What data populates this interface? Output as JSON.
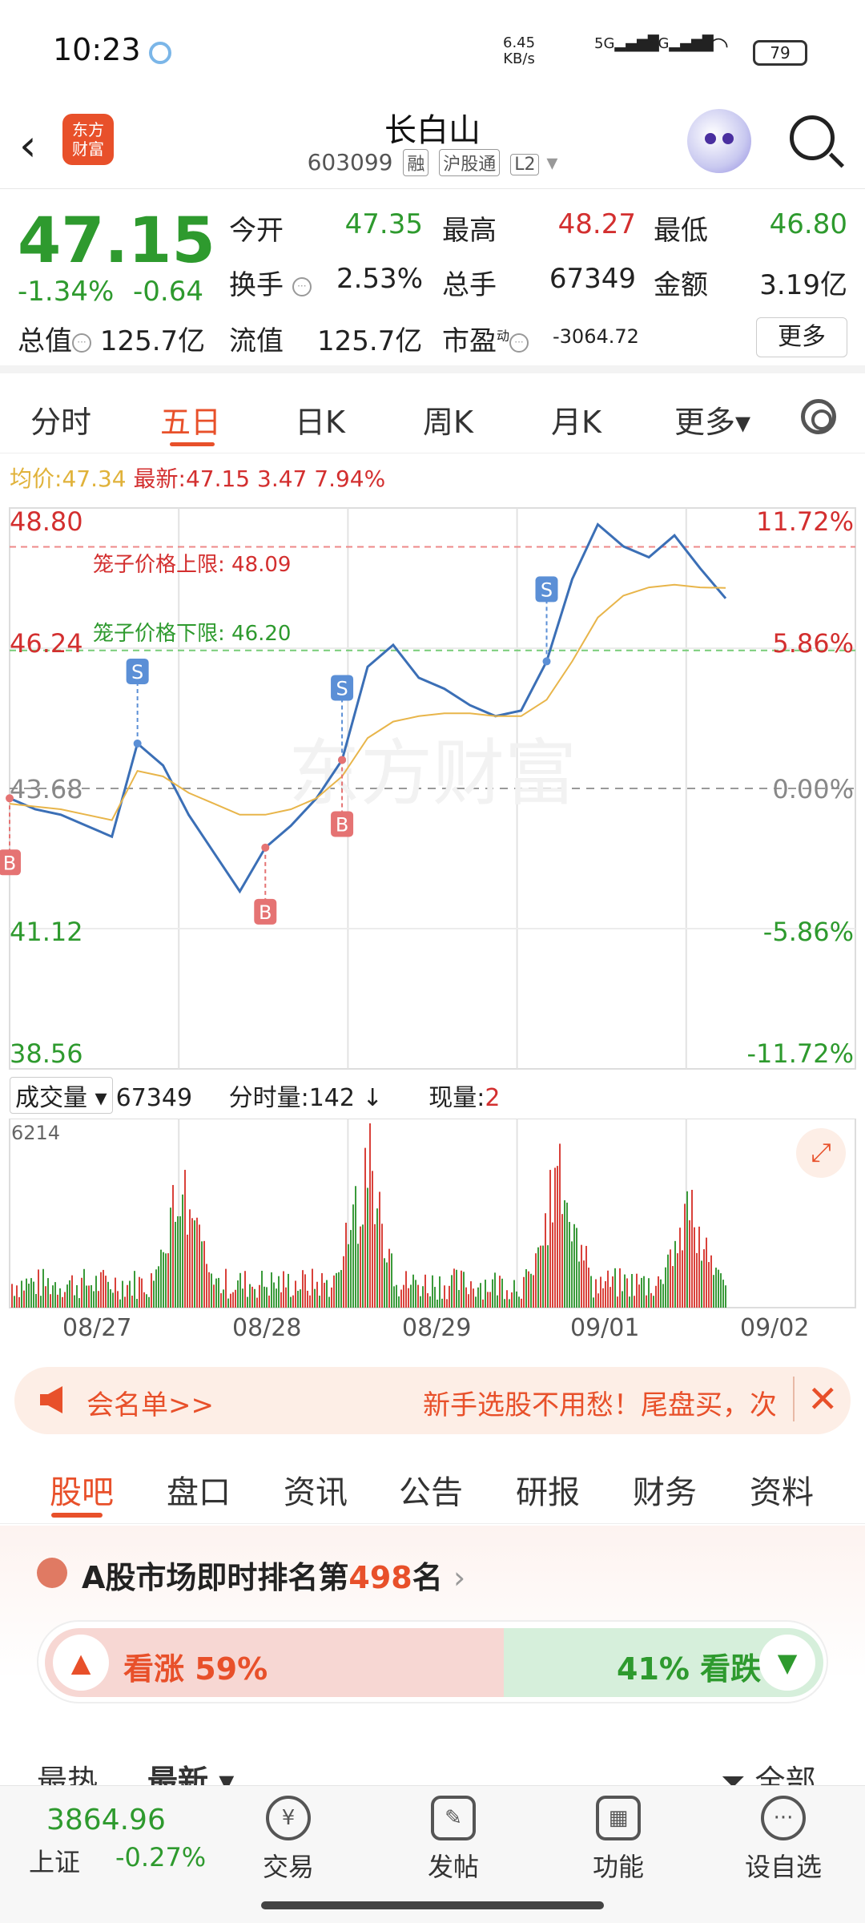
{
  "status": {
    "time": "10:23",
    "speed": "6.45\nKB/s",
    "net1": "5G",
    "net2": "4G",
    "battery": "79"
  },
  "header": {
    "back": "‹",
    "logo": "东方\n财富",
    "title": "长白山",
    "code": "603099",
    "tags": [
      "融",
      "沪股通",
      "L2"
    ]
  },
  "quote": {
    "price": "47.15",
    "chg_pct": "-1.34%",
    "chg": "-0.64",
    "rows": [
      [
        {
          "label": "今开",
          "value": "47.35",
          "color": "green"
        },
        {
          "label": "最高",
          "value": "48.27",
          "color": "red"
        },
        {
          "label": "最低",
          "value": "46.80",
          "color": "green"
        }
      ],
      [
        {
          "label": "换手",
          "value": "2.53%",
          "color": "black"
        },
        {
          "label": "总手",
          "value": "67349",
          "color": "black"
        },
        {
          "label": "金额",
          "value": "3.19亿",
          "color": "black"
        }
      ]
    ],
    "total_cap_label": "总值",
    "total_cap": "125.7亿",
    "float_cap_label": "流值",
    "float_cap": "125.7亿",
    "pe_label": "市盈",
    "pe_sup": "动",
    "pe": "-3064.72",
    "more": "更多"
  },
  "chart_tabs": [
    "分时",
    "五日",
    "日K",
    "周K",
    "月K",
    "更多▾"
  ],
  "avg_line": {
    "avg_label": "均价:",
    "avg": "47.34",
    "latest_label": "最新:",
    "latest": "47.15",
    "amt": "3.47",
    "pct": "7.94%"
  },
  "chart": {
    "left_axis": [
      "48.80",
      "46.24",
      "43.68",
      "41.12",
      "38.56"
    ],
    "right_axis": [
      "11.72%",
      "5.86%",
      "0.00%",
      "-5.86%",
      "-11.72%"
    ],
    "cage_upper": "笼子价格上限: 48.09",
    "cage_lower": "笼子价格下限: 46.20",
    "markers": [
      "B",
      "S",
      "B",
      "S",
      "B",
      "S"
    ],
    "watermark": "东方财富"
  },
  "chart_data": {
    "type": "line",
    "title": "",
    "x": [
      "08/27",
      "08/28",
      "08/29",
      "09/01",
      "09/02"
    ],
    "ylim": [
      38.56,
      48.8
    ],
    "series": [
      {
        "name": "最新",
        "values": [
          43.5,
          43.3,
          43.2,
          43.0,
          42.8,
          44.5,
          44.1,
          43.2,
          42.5,
          41.8,
          42.6,
          43.0,
          43.5,
          44.2,
          45.9,
          46.3,
          45.7,
          45.5,
          45.2,
          45.0,
          45.1,
          46.0,
          47.5,
          48.5,
          48.1,
          47.9,
          48.3,
          47.7,
          47.15
        ]
      },
      {
        "name": "均价",
        "values": [
          43.4,
          43.35,
          43.3,
          43.2,
          43.1,
          44.0,
          43.9,
          43.6,
          43.4,
          43.2,
          43.2,
          43.3,
          43.5,
          43.9,
          44.6,
          44.9,
          45.0,
          45.05,
          45.05,
          45.0,
          45.0,
          45.3,
          46.0,
          46.8,
          47.2,
          47.35,
          47.4,
          47.35,
          47.34
        ]
      }
    ]
  },
  "volume": {
    "label": "成交量",
    "total": "67349",
    "tick_label": "分时量:142",
    "arrow": "↓",
    "now_label": "现量:",
    "now": "2",
    "max": "6214"
  },
  "dates": [
    "08/27",
    "08/28",
    "08/29",
    "09/01",
    "09/02"
  ],
  "banner": {
    "left": "会名单>>",
    "right": "新手选股不用愁！尾盘买，次",
    "close": "✕"
  },
  "main_tabs": [
    "股吧",
    "盘口",
    "资讯",
    "公告",
    "研报",
    "财务",
    "资料"
  ],
  "rank": {
    "prefix": "A股市场即时排名第",
    "num": "498",
    "suffix": "名",
    "up_label": "看涨 59%",
    "down_label": "41% 看跌",
    "up_pct": 59
  },
  "sort": {
    "hot": "最热",
    "new": "最新",
    "all": "全部"
  },
  "bottom": {
    "index_val": "3864.96",
    "index_name": "上证",
    "index_chg": "-0.27%",
    "nav": [
      {
        "icon": "¥",
        "label": "交易"
      },
      {
        "icon": "✎",
        "label": "发帖"
      },
      {
        "icon": "▦",
        "label": "功能"
      },
      {
        "icon": "···",
        "label": "设自选"
      }
    ]
  }
}
